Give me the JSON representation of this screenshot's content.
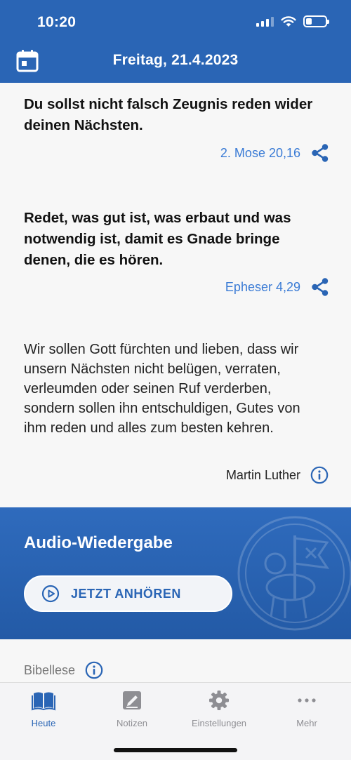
{
  "status_bar": {
    "time": "10:20",
    "battery_level": 0.3
  },
  "header": {
    "title": "Freitag, 21.4.2023",
    "calendar_icon": "calendar-icon"
  },
  "texts": [
    {
      "verse": "Du sollst nicht falsch Zeugnis reden wider deinen Nächsten.",
      "reference": "2. Mose 20,16"
    },
    {
      "verse": "Redet, was gut ist, was erbaut und was notwendig ist, damit es Gnade bringe denen, die es hören.",
      "reference": "Epheser 4,29"
    }
  ],
  "luther": {
    "text": "Wir sollen Gott fürchten und lieben, dass wir unsern Nächsten nicht belügen, verraten, verleumden oder seinen Ruf verderben, sondern sollen ihn entschuldigen, Gutes von ihm reden und alles zum besten kehren.",
    "author": "Martin Luther"
  },
  "audio": {
    "title": "Audio-Wiedergabe",
    "button_label": "JETZT ANHÖREN"
  },
  "bibellese": {
    "label": "Bibellese"
  },
  "tabs": [
    {
      "label": "Heute",
      "icon": "book-icon",
      "active": true
    },
    {
      "label": "Notizen",
      "icon": "note-icon",
      "active": false
    },
    {
      "label": "Einstellungen",
      "icon": "gear-icon",
      "active": false
    },
    {
      "label": "Mehr",
      "icon": "more-icon",
      "active": false
    }
  ],
  "colors": {
    "primary": "#2a65b5",
    "link": "#3a7bd5",
    "background": "#f7f7f7"
  }
}
